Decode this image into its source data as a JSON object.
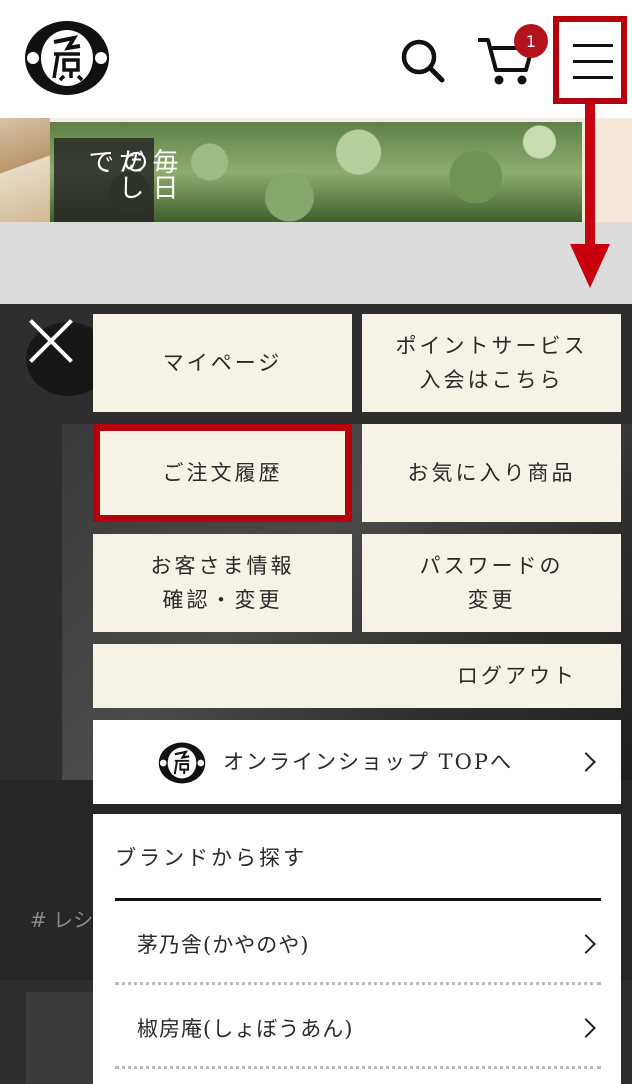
{
  "header": {
    "logo_icon": "kuhara-logo-icon",
    "search_icon": "search-icon",
    "cart_icon": "cart-icon",
    "cart_count": "1",
    "menu_icon": "hamburger-menu-icon",
    "accent_color": "#b3000c"
  },
  "hero": {
    "text_col1": "毎日の",
    "text_col2": "だしで"
  },
  "page_behind": {
    "tag_text": "# レシ"
  },
  "menu": {
    "close_icon": "close-icon",
    "mypage": "マイページ",
    "point_line1": "ポイントサービス",
    "point_line2": "入会はこちら",
    "order_history": "ご注文履歴",
    "favorites": "お気に入り商品",
    "customer_line1": "お客さま情報",
    "customer_line2": "確認・変更",
    "password_line1": "パスワードの",
    "password_line2": "変更",
    "logout": "ログアウト",
    "online_top": "オンラインショップ TOPへ",
    "tile_color": "#f6f3e6"
  },
  "brands": {
    "title": "ブランドから探す",
    "items": [
      {
        "label": "茅乃舎(かやのや)"
      },
      {
        "label": "椒房庵(しょぼうあん)"
      }
    ]
  }
}
